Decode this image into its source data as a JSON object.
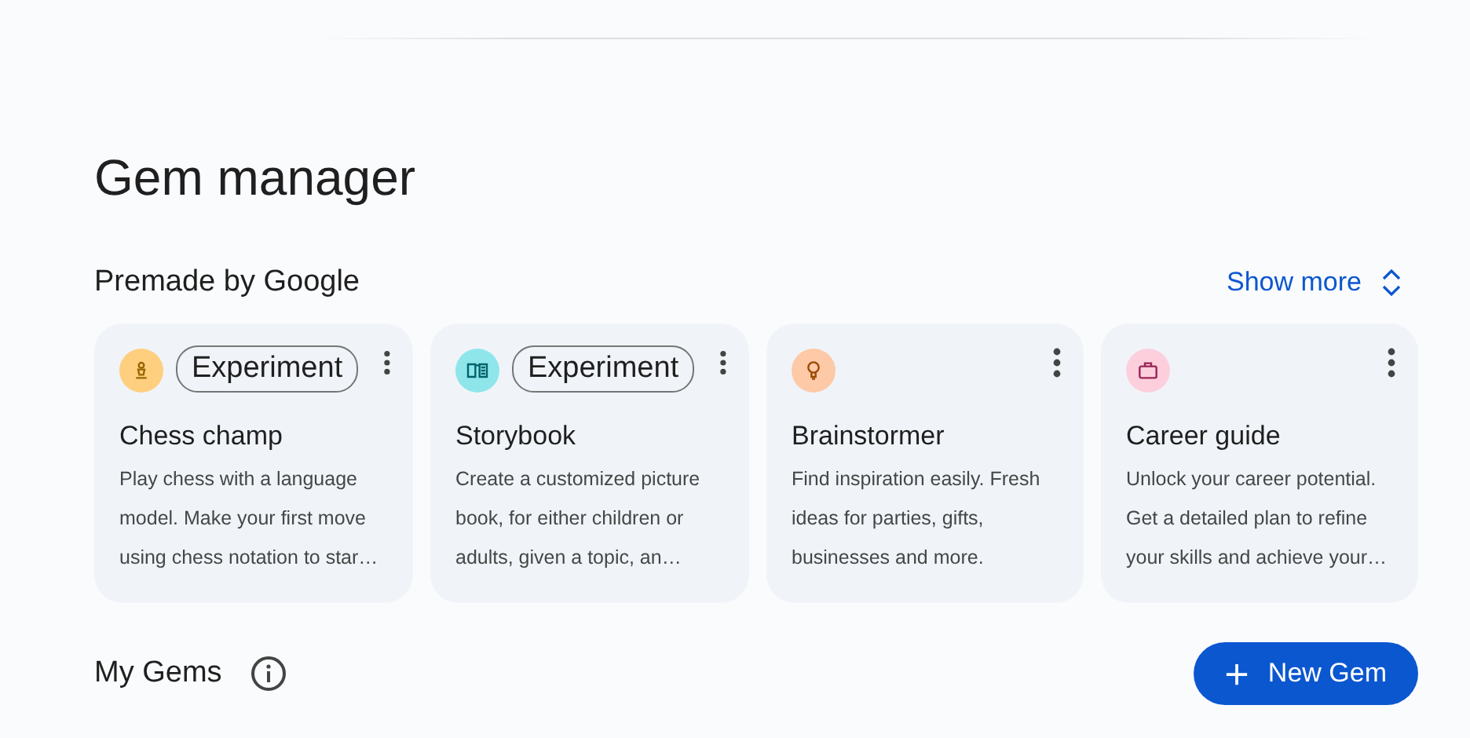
{
  "title": "Gem manager",
  "premade": {
    "heading": "Premade by Google",
    "show_more": "Show more",
    "cards": [
      {
        "color": "#fdcf7f",
        "badge": "Experiment",
        "name": "Chess champ",
        "description": "Play chess with a language model. Make your first move using chess notation to star…"
      },
      {
        "color": "#8fe6ea",
        "badge": "Experiment",
        "name": "Storybook",
        "description": "Create a customized picture book, for either children or adults, given a topic, an…"
      },
      {
        "color": "#fdc9a6",
        "name": "Brainstormer",
        "description": "Find inspiration easily. Fresh ideas for parties, gifts, businesses and more."
      },
      {
        "color": "#fdcfdc",
        "name": "Career guide",
        "description": "Unlock your career potential. Get a detailed plan to refine your skills and achieve your…"
      }
    ]
  },
  "my_gems": {
    "heading": "My Gems",
    "new_button": "New Gem"
  }
}
